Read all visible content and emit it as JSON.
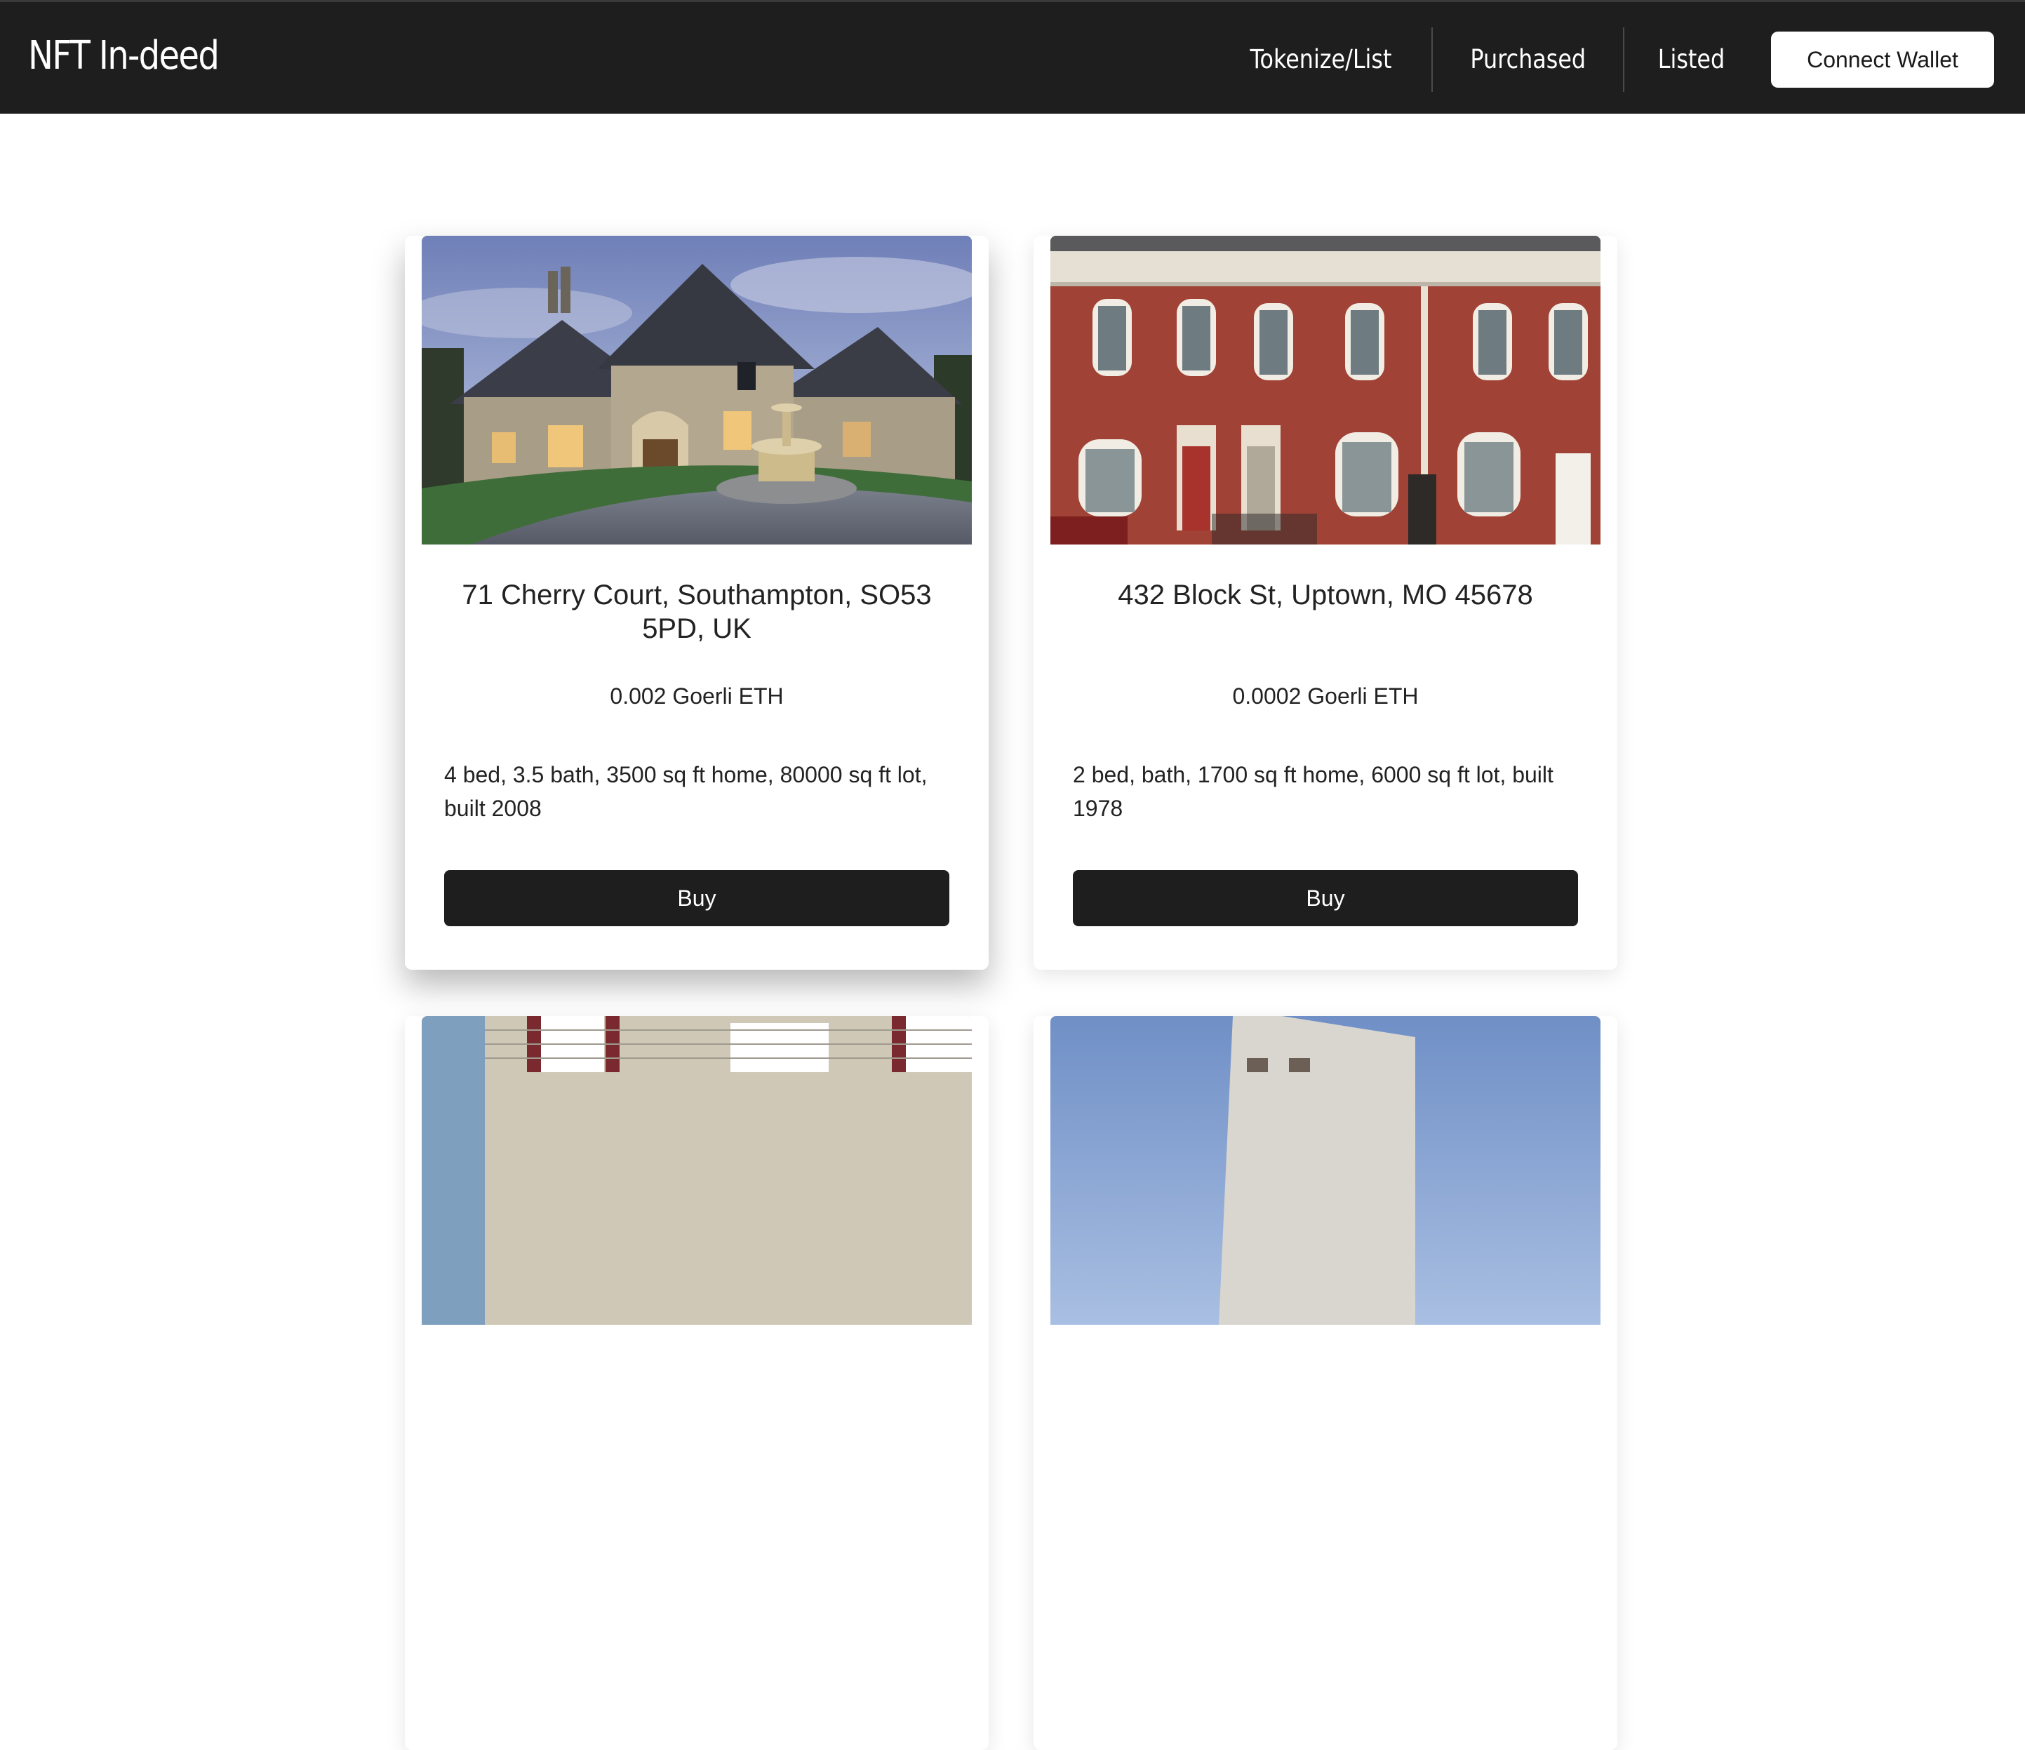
{
  "nav": {
    "brand": "NFT In-deed",
    "links": [
      "Tokenize/List",
      "Purchased",
      "Listed"
    ],
    "connect_label": "Connect Wallet"
  },
  "listings": [
    {
      "address": "71 Cherry Court, Southampton, SO53 5PD, UK",
      "price": "0.002 Goerli ETH",
      "description": "4 bed, 3.5 bath, 3500 sq ft home, 80000 sq ft lot, built 2008",
      "buy_label": "Buy"
    },
    {
      "address": "432 Block St, Uptown, MO 45678",
      "price": "0.0002 Goerli ETH",
      "description": "2 bed, bath, 1700 sq ft home, 6000 sq ft lot, built 1978",
      "buy_label": "Buy"
    }
  ],
  "colors": {
    "nav_bg": "#1e1e1e",
    "button_dark": "#1e1e1e",
    "page_bg": "#ffffff"
  }
}
